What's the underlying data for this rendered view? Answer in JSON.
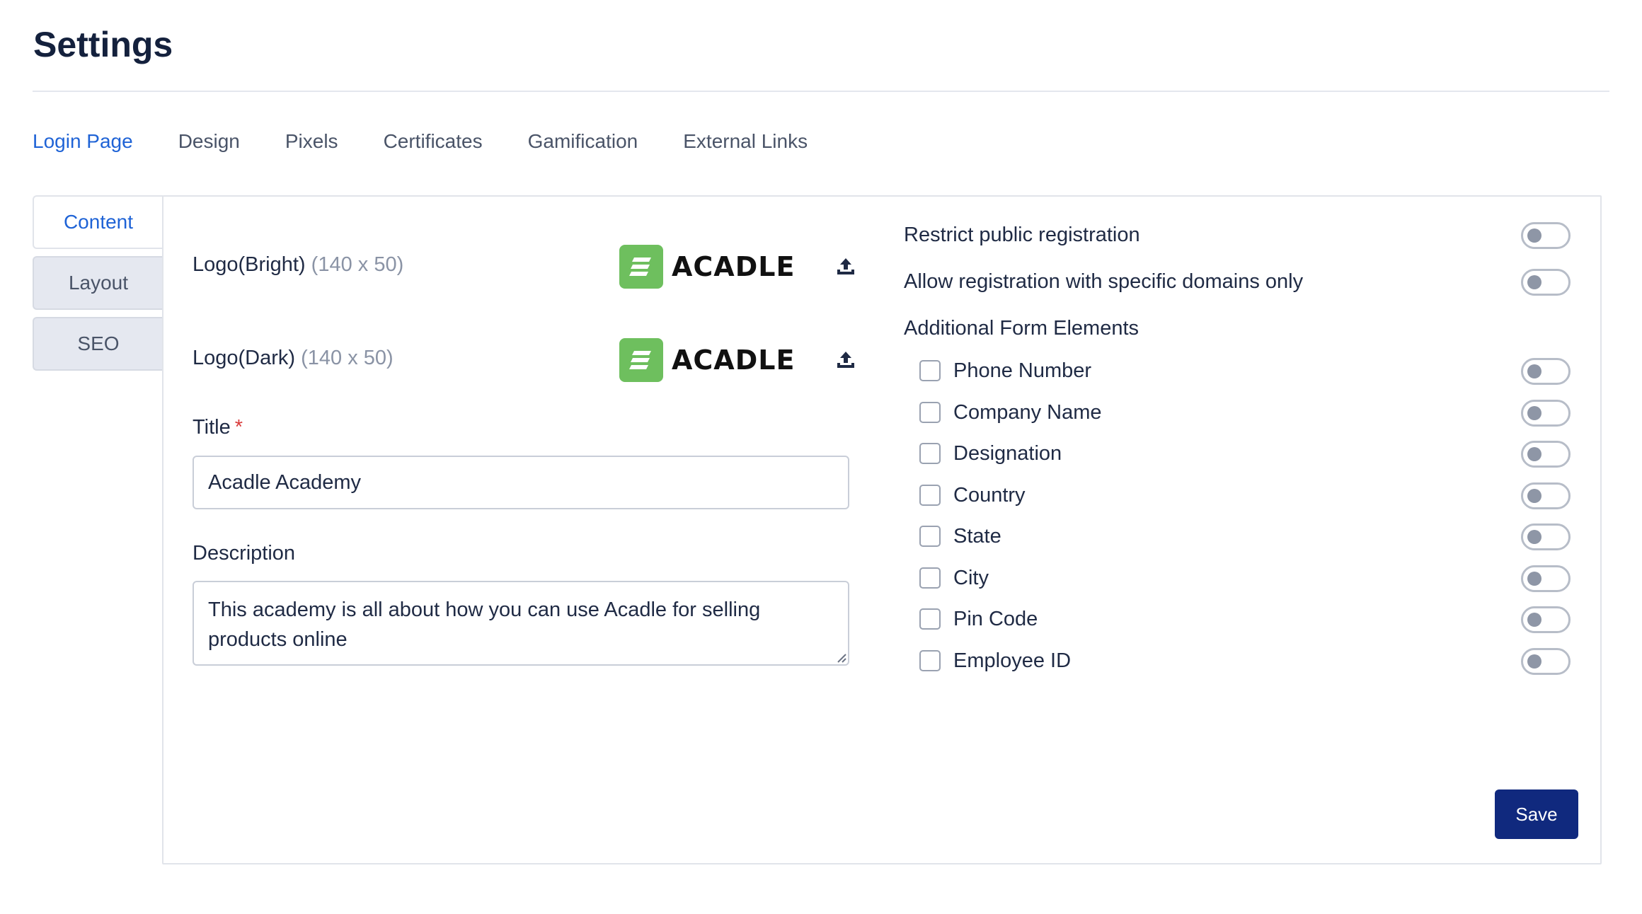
{
  "page": {
    "title": "Settings"
  },
  "tabs": [
    {
      "label": "Login Page",
      "active": true
    },
    {
      "label": "Design"
    },
    {
      "label": "Pixels"
    },
    {
      "label": "Certificates"
    },
    {
      "label": "Gamification"
    },
    {
      "label": "External Links"
    }
  ],
  "side_tabs": [
    {
      "label": "Content",
      "active": true
    },
    {
      "label": "Layout"
    },
    {
      "label": "SEO"
    }
  ],
  "logos": {
    "bright": {
      "label": "Logo(Bright)",
      "size": "(140 x 50)",
      "brand_text": "ACADLE",
      "icon": "upload-icon"
    },
    "dark": {
      "label": "Logo(Dark)",
      "size": "(140 x 50)",
      "brand_text": "ACADLE",
      "icon": "upload-icon"
    }
  },
  "title_field": {
    "label": "Title",
    "required_mark": "*",
    "value": "Acadle Academy"
  },
  "description_field": {
    "label": "Description",
    "value": "This academy is all about how you can use Acadle for selling products online"
  },
  "registration": {
    "restrict_label": "Restrict public registration",
    "restrict_enabled": false,
    "domains_label": "Allow registration with specific domains only",
    "domains_enabled": false
  },
  "form_elements": {
    "heading": "Additional Form Elements",
    "items": [
      {
        "label": "Phone Number",
        "checked": false,
        "enabled": false
      },
      {
        "label": "Company Name",
        "checked": false,
        "enabled": false
      },
      {
        "label": "Designation",
        "checked": false,
        "enabled": false
      },
      {
        "label": "Country",
        "checked": false,
        "enabled": false
      },
      {
        "label": "State",
        "checked": false,
        "enabled": false
      },
      {
        "label": "City",
        "checked": false,
        "enabled": false
      },
      {
        "label": "Pin Code",
        "checked": false,
        "enabled": false
      },
      {
        "label": "Employee ID",
        "checked": false,
        "enabled": false
      }
    ]
  },
  "actions": {
    "save_label": "Save"
  },
  "colors": {
    "accent": "#1f63d6",
    "brand_green": "#6ebf5e",
    "primary_button": "#10297e",
    "required": "#d93c3c"
  }
}
